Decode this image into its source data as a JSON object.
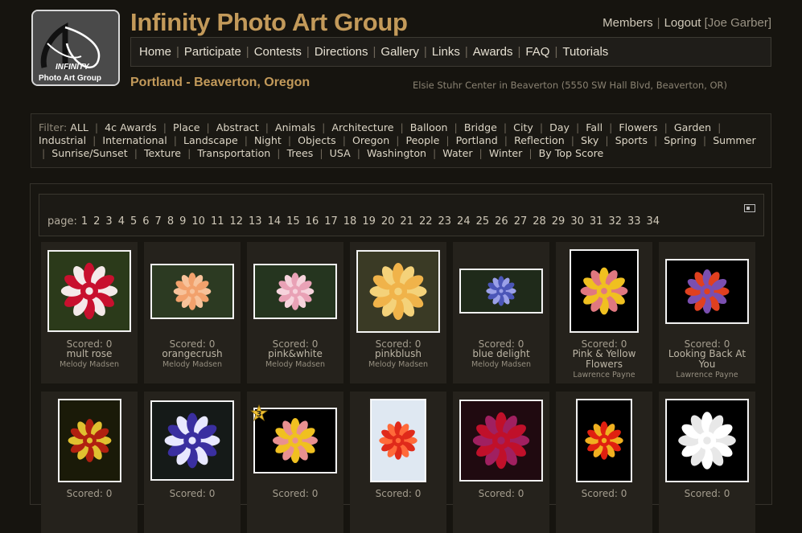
{
  "site": {
    "title": "Infinity Photo Art Group",
    "logo_text_1": "INFINITY",
    "logo_text_2": "Photo Art Group"
  },
  "user_nav": {
    "members": "Members",
    "logout": "Logout",
    "user": "[Joe Garber]"
  },
  "nav": [
    "Home",
    "Participate",
    "Contests",
    "Directions",
    "Gallery",
    "Links",
    "Awards",
    "FAQ",
    "Tutorials"
  ],
  "location": "Portland - Beaverton, Oregon",
  "address": "Elsie Stuhr Center in Beaverton (5550 SW Hall Blvd, Beaverton, OR)",
  "filter": {
    "label": "Filter:",
    "items": [
      "ALL",
      "4c Awards",
      "Place",
      "Abstract",
      "Animals",
      "Architecture",
      "Balloon",
      "Bridge",
      "City",
      "Day",
      "Fall",
      "Flowers",
      "Garden",
      "Industrial",
      "International",
      "Landscape",
      "Night",
      "Objects",
      "Oregon",
      "People",
      "Portland",
      "Reflection",
      "Sky",
      "Sports",
      "Spring",
      "Summer",
      "Sunrise/Sunset",
      "Texture",
      "Transportation",
      "Trees",
      "USA",
      "Washington",
      "Water",
      "Winter",
      "By Top Score"
    ]
  },
  "pager": {
    "label": "page:",
    "pages": [
      "1",
      "2",
      "3",
      "4",
      "5",
      "6",
      "7",
      "8",
      "9",
      "10",
      "11",
      "12",
      "13",
      "14",
      "15",
      "16",
      "17",
      "18",
      "19",
      "20",
      "21",
      "22",
      "23",
      "24",
      "25",
      "26",
      "27",
      "28",
      "29",
      "30",
      "31",
      "32",
      "33",
      "34"
    ]
  },
  "photos": [
    {
      "score": "Scored: 0",
      "title": "mult rose",
      "author": "Melody Madsen",
      "icon": "red-white-rose-photo"
    },
    {
      "score": "Scored: 0",
      "title": "orangecrush",
      "author": "Melody Madsen",
      "icon": "orange-rose-photo"
    },
    {
      "score": "Scored: 0",
      "title": "pink&white",
      "author": "Melody Madsen",
      "icon": "pink-rose-photo"
    },
    {
      "score": "Scored: 0",
      "title": "pinkblush",
      "author": "Melody Madsen",
      "icon": "yellow-rose-photo"
    },
    {
      "score": "Scored: 0",
      "title": "blue delight",
      "author": "Melody Madsen",
      "icon": "blue-clematis-photo"
    },
    {
      "score": "Scored: 0",
      "title": "Pink & Yellow Flowers",
      "author": "Lawrence Payne",
      "icon": "pink-yellow-flowers-photo"
    },
    {
      "score": "Scored: 0",
      "title": "Looking Back At You",
      "author": "Lawrence Payne",
      "icon": "daisies-photo"
    },
    {
      "score": "Scored: 0",
      "title": "",
      "author": "",
      "icon": "pitcher-plant-photo"
    },
    {
      "score": "Scored: 0",
      "title": "",
      "author": "",
      "icon": "blue-daisy-photo"
    },
    {
      "score": "Scored: 0",
      "title": "",
      "author": "",
      "icon": "yellow-pink-flowers-photo",
      "award": "3"
    },
    {
      "score": "Scored: 0",
      "title": "",
      "author": "",
      "icon": "red-dahlia-photo"
    },
    {
      "score": "Scored: 0",
      "title": "",
      "author": "",
      "icon": "magenta-dahlia-photo"
    },
    {
      "score": "Scored: 0",
      "title": "",
      "author": "",
      "icon": "red-gerbera-photo"
    },
    {
      "score": "Scored: 0",
      "title": "",
      "author": "",
      "icon": "white-daisies-photo"
    }
  ]
}
